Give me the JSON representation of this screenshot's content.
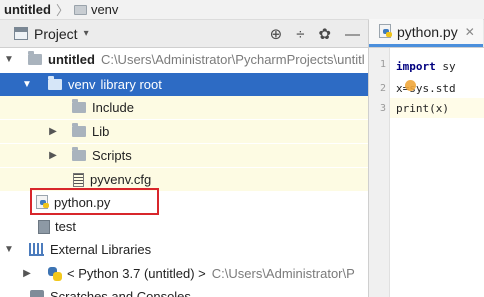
{
  "nav_bar": {
    "project_name": "untitled",
    "separator": "〉",
    "folder_name": "venv"
  },
  "project_panel": {
    "title": "Project",
    "caret": "▾",
    "tools": {
      "target": "⊕",
      "collapse": "÷",
      "settings": "✿",
      "hide": "—"
    }
  },
  "editor": {
    "tab_label": "python.py",
    "tab_close": "✕",
    "lines": [
      {
        "number": "1",
        "keyword": "import",
        "text": " sy"
      },
      {
        "number": "2",
        "keyword": "",
        "text": "x=sys.std"
      },
      {
        "number": "3",
        "keyword": "",
        "text": "print(x)"
      }
    ]
  },
  "tree": {
    "untitled": {
      "label": "untitled",
      "path": "C:\\Users\\Administrator\\PycharmProjects\\untitl"
    },
    "venv": {
      "label": "venv",
      "suffix": "library root"
    },
    "include": "Include",
    "lib": "Lib",
    "scripts": "Scripts",
    "pyvenv": "pyvenv.cfg",
    "python_file": "python.py",
    "test": "test",
    "external_libraries": "External Libraries",
    "python_sdk": {
      "label": "< Python 3.7 (untitled) >",
      "path": "C:\\Users\\Administrator\\P"
    },
    "scratches": "Scratches and Consoles"
  },
  "arrows": {
    "expanded": "▼",
    "collapsed": "▶"
  },
  "colors": {
    "selection": "#2d6bc4",
    "highlight_bg": "#fdfbe3",
    "annotation_box": "#d8262b"
  }
}
